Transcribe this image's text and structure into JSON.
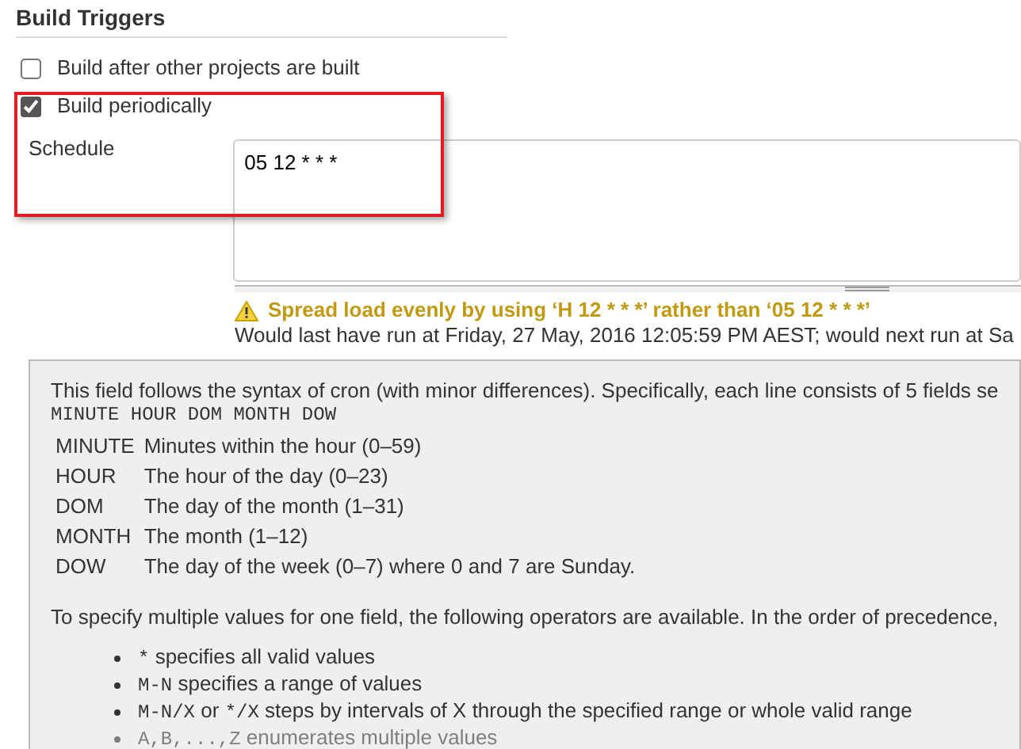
{
  "section": {
    "title": "Build Triggers"
  },
  "triggers": [
    {
      "label": "Build after other projects are built",
      "checked": false
    },
    {
      "label": "Build periodically",
      "checked": true
    }
  ],
  "highlight_frame": true,
  "schedule": {
    "label": "Schedule",
    "value": "05 12 * * *"
  },
  "warning": "Spread load evenly by using ‘H 12 * * *’ rather than ‘05 12 * * *’",
  "info": "Would last have run at Friday, 27 May, 2016 12:05:59 PM AEST; would next run at Sa",
  "help": {
    "intro": "This field follows the syntax of cron (with minor differences). Specifically, each line consists of 5 fields se",
    "syntax": "MINUTE HOUR DOM MONTH DOW",
    "fields": [
      {
        "name": "MINUTE",
        "desc": "Minutes within the hour (0–59)"
      },
      {
        "name": "HOUR",
        "desc": "The hour of the day (0–23)"
      },
      {
        "name": "DOM",
        "desc": "The day of the month (1–31)"
      },
      {
        "name": "MONTH",
        "desc": "The month (1–12)"
      },
      {
        "name": "DOW",
        "desc": "The day of the week (0–7) where 0 and 7 are Sunday."
      }
    ],
    "operators_intro": "To specify multiple values for one field, the following operators are available. In the order of precedence,",
    "operators": [
      [
        {
          "kind": "code",
          "text": "*"
        },
        {
          "kind": "text",
          "text": " specifies all valid values"
        }
      ],
      [
        {
          "kind": "code",
          "text": "M-N"
        },
        {
          "kind": "text",
          "text": " specifies a range of values"
        }
      ],
      [
        {
          "kind": "code",
          "text": "M-N/X"
        },
        {
          "kind": "text",
          "text": " or "
        },
        {
          "kind": "code",
          "text": "*/X"
        },
        {
          "kind": "text",
          "text": " steps by intervals of X through the specified range or whole valid range"
        }
      ],
      [
        {
          "kind": "code",
          "text": "A,B,...,Z"
        },
        {
          "kind": "text",
          "text": " enumerates multiple values"
        }
      ]
    ]
  }
}
